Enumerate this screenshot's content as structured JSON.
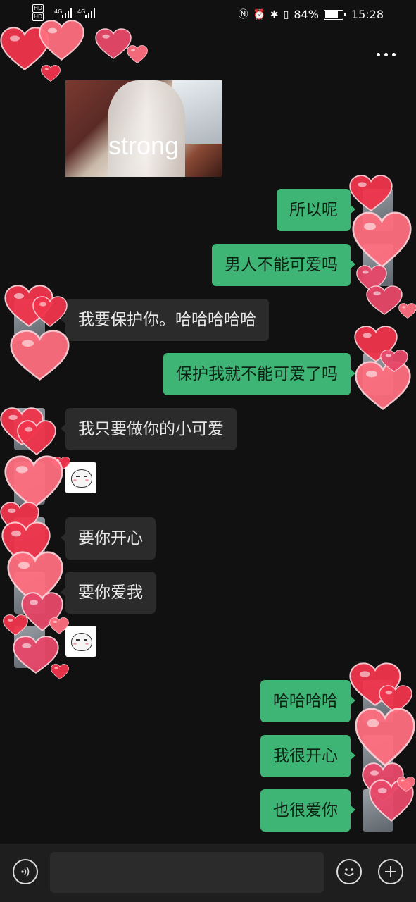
{
  "status_bar": {
    "hd_label": "HD",
    "network": "4G",
    "battery": "84%",
    "battery_level": 0.84,
    "time": "15:28",
    "icons": [
      "nfc-icon",
      "alarm-icon",
      "bluetooth-icon",
      "vibrate-icon",
      "battery-icon"
    ]
  },
  "header": {
    "more_icon": "more-dots-icon"
  },
  "photo": {
    "caption": "strong"
  },
  "messages": [
    {
      "side": "me",
      "text": "所以呢"
    },
    {
      "side": "me",
      "text": "男人不能可爱吗"
    },
    {
      "side": "them",
      "text": "我要保护你。哈哈哈哈哈"
    },
    {
      "side": "me",
      "text": "保护我就不能可爱了吗"
    },
    {
      "side": "them",
      "text": "我只要做你的小可爱"
    },
    {
      "side": "them",
      "sticker": "cat-sticker"
    },
    {
      "side": "them",
      "text": "要你开心"
    },
    {
      "side": "them",
      "text": "要你爱我"
    },
    {
      "side": "them",
      "sticker": "cat-sticker"
    },
    {
      "side": "me",
      "text": "哈哈哈哈"
    },
    {
      "side": "me",
      "text": "我很开心"
    },
    {
      "side": "me",
      "text": "也很爱你"
    }
  ],
  "bottom_bar": {
    "voice_icon": "voice-icon",
    "input_value": "",
    "emoji_icon": "emoji-icon",
    "plus_icon": "plus-icon"
  },
  "colors": {
    "background": "#111111",
    "my_bubble": "#3eb575",
    "their_bubble": "#2b2b2b",
    "hearts": [
      "#f0344c",
      "#ff6f7f",
      "#e8486a"
    ]
  }
}
